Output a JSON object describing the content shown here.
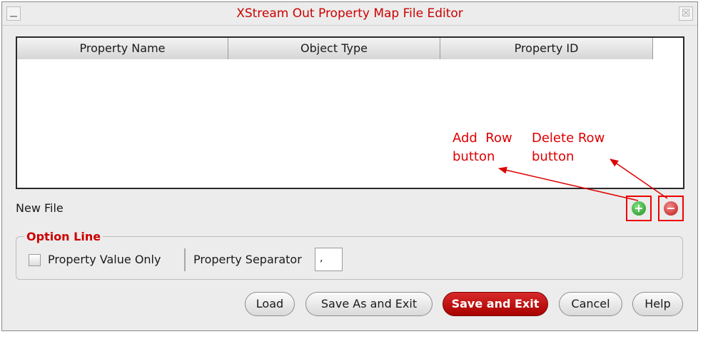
{
  "window": {
    "title": "XStream Out Property Map File Editor",
    "close_glyph": "☒"
  },
  "table": {
    "columns": [
      "Property Name",
      "Object Type",
      "Property ID"
    ],
    "rows": []
  },
  "status": "New File",
  "row_buttons": {
    "add_glyph": "+",
    "delete_glyph": "−"
  },
  "options": {
    "legend": "Option Line",
    "checkbox_label": "Property Value Only",
    "checkbox_checked": false,
    "separator_label": "Property Separator",
    "separator_value": ","
  },
  "buttons": {
    "load": "Load",
    "save_as_exit": "Save As and Exit",
    "save_exit": "Save and Exit",
    "cancel": "Cancel",
    "help": "Help"
  },
  "annotations": {
    "add_row": [
      "Add  Row",
      "button"
    ],
    "delete_row": [
      "Delete Row",
      "button"
    ],
    "color": "#dd0000"
  },
  "colors": {
    "title": "#cc0000",
    "primary_button": "#c01818",
    "add_icon": "#2fa82f",
    "delete_icon": "#d42a2a"
  }
}
